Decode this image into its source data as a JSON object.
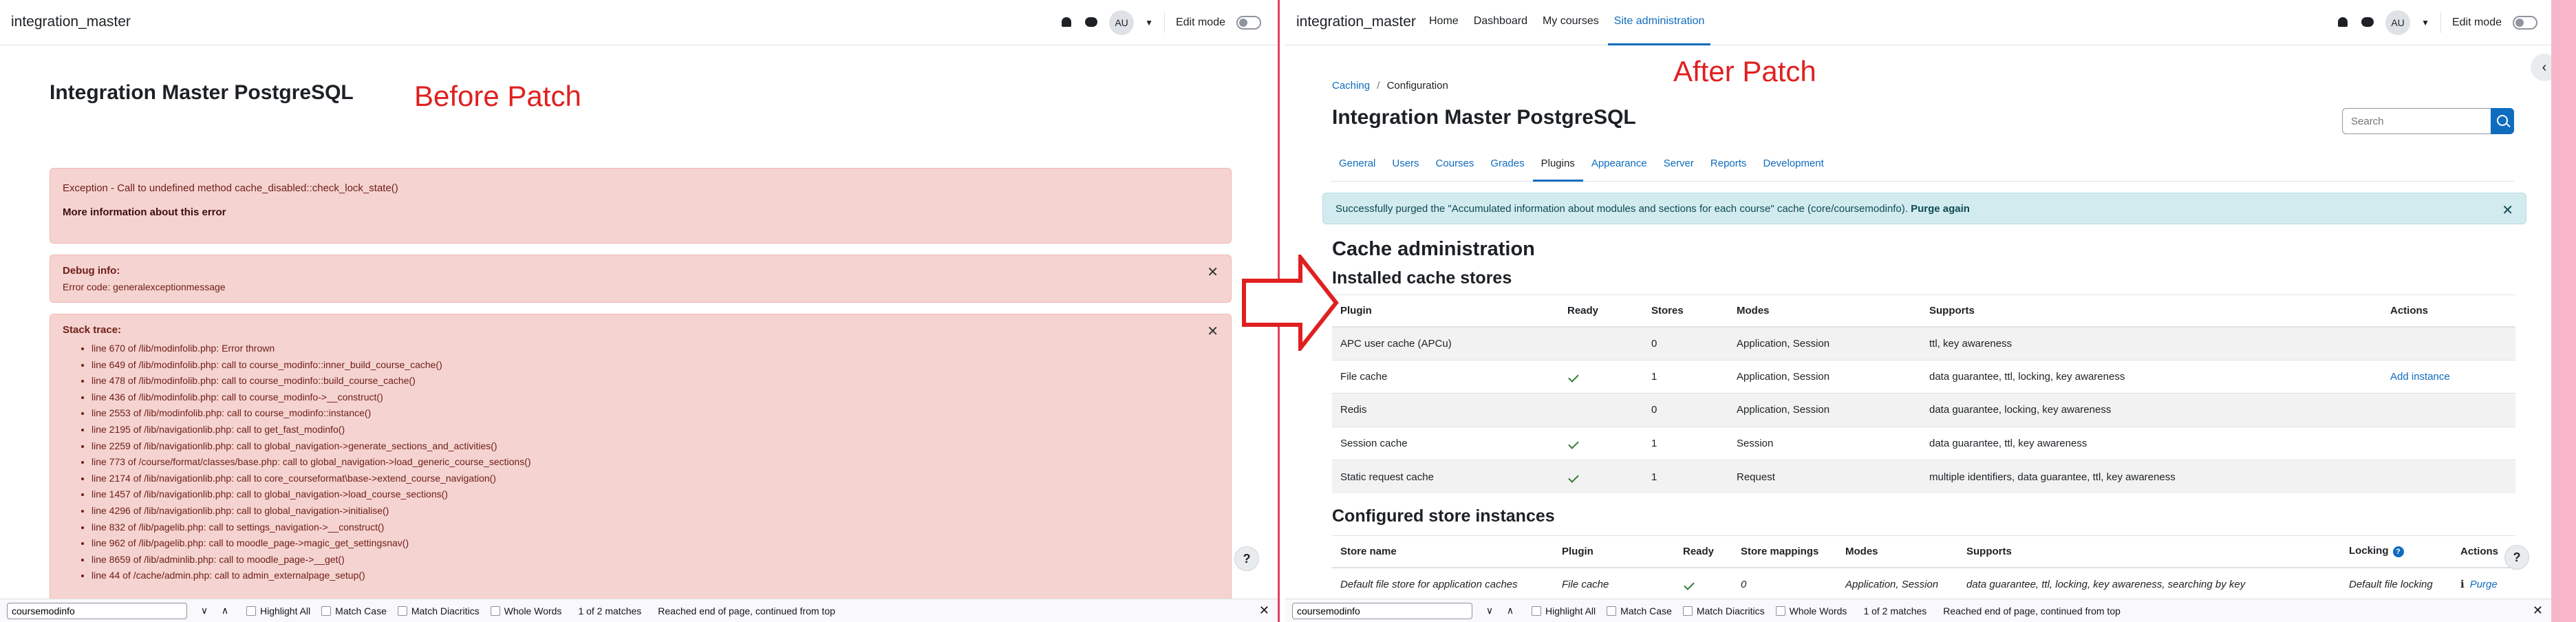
{
  "left": {
    "brand": "integration_master",
    "avatar": "AU",
    "edit_mode": "Edit mode",
    "label": "Before Patch",
    "page_title": "Integration Master PostgreSQL",
    "exception": {
      "message": "Exception - Call to undefined method cache_disabled::check_lock_state()",
      "more_info": "More information about this error"
    },
    "debug": {
      "title": "Debug info:",
      "code": "Error code: generalexceptionmessage"
    },
    "trace": {
      "title": "Stack trace:",
      "lines": [
        "line 670 of /lib/modinfolib.php: Error thrown",
        "line 649 of /lib/modinfolib.php: call to course_modinfo::inner_build_course_cache()",
        "line 478 of /lib/modinfolib.php: call to course_modinfo::build_course_cache()",
        "line 436 of /lib/modinfolib.php: call to course_modinfo->__construct()",
        "line 2553 of /lib/modinfolib.php: call to course_modinfo::instance()",
        "line 2195 of /lib/navigationlib.php: call to get_fast_modinfo()",
        "line 2259 of /lib/navigationlib.php: call to global_navigation->generate_sections_and_activities()",
        "line 773 of /course/format/classes/base.php: call to global_navigation->load_generic_course_sections()",
        "line 2174 of /lib/navigationlib.php: call to core_courseformat\\base->extend_course_navigation()",
        "line 1457 of /lib/navigationlib.php: call to global_navigation->load_course_sections()",
        "line 4296 of /lib/navigationlib.php: call to global_navigation->initialise()",
        "line 832 of /lib/pagelib.php: call to settings_navigation->__construct()",
        "line 962 of /lib/pagelib.php: call to moodle_page->magic_get_settingsnav()",
        "line 8659 of /lib/adminlib.php: call to moodle_page->__get()",
        "line 44 of /cache/admin.php: call to admin_externalpage_setup()"
      ]
    },
    "help": "?",
    "find": {
      "value": "coursemodinfo",
      "highlight": "Highlight All",
      "match_case": "Match Case",
      "diacritics": "Match Diacritics",
      "whole_words": "Whole Words",
      "matches": "1 of 2 matches",
      "status": "Reached end of page, continued from top"
    }
  },
  "right": {
    "brand": "integration_master",
    "nav": [
      "Home",
      "Dashboard",
      "My courses",
      "Site administration"
    ],
    "avatar": "AU",
    "edit_mode": "Edit mode",
    "label": "After Patch",
    "breadcrumb": {
      "link": "Caching",
      "sep": "/",
      "current": "Configuration"
    },
    "page_title": "Integration Master PostgreSQL",
    "search_placeholder": "Search",
    "tabs": [
      "General",
      "Users",
      "Courses",
      "Grades",
      "Plugins",
      "Appearance",
      "Server",
      "Reports",
      "Development"
    ],
    "success": {
      "message": "Successfully purged the \"Accumulated information about modules and sections for each course\" cache (core/coursemodinfo).",
      "action": "Purge again"
    },
    "cache_admin": "Cache administration",
    "installed_title": "Installed cache stores",
    "installed": {
      "headers": [
        "Plugin",
        "Ready",
        "Stores",
        "Modes",
        "Supports",
        "Actions"
      ],
      "rows": [
        {
          "plugin": "APC user cache (APCu)",
          "ready": false,
          "stores": "0",
          "modes": "Application, Session",
          "supports": "ttl, key awareness",
          "action": ""
        },
        {
          "plugin": "File cache",
          "ready": true,
          "stores": "1",
          "modes": "Application, Session",
          "supports": "data guarantee, ttl, locking, key awareness",
          "action": "Add instance"
        },
        {
          "plugin": "Redis",
          "ready": false,
          "stores": "0",
          "modes": "Application, Session",
          "supports": "data guarantee, locking, key awareness",
          "action": ""
        },
        {
          "plugin": "Session cache",
          "ready": true,
          "stores": "1",
          "modes": "Session",
          "supports": "data guarantee, ttl, key awareness",
          "action": ""
        },
        {
          "plugin": "Static request cache",
          "ready": true,
          "stores": "1",
          "modes": "Request",
          "supports": "multiple identifiers, data guarantee, ttl, key awareness",
          "action": ""
        }
      ]
    },
    "configured_title": "Configured store instances",
    "configured": {
      "headers": [
        "Store name",
        "Plugin",
        "Ready",
        "Store mappings",
        "Modes",
        "Supports",
        "Locking",
        "Actions"
      ],
      "rows": [
        {
          "name": "Default file store for application caches",
          "plugin": "File cache",
          "ready": true,
          "mappings": "0",
          "modes": "Application, Session",
          "supports": "data guarantee, ttl, locking, key awareness, searching by key",
          "locking": "Default file locking",
          "action": "Purge"
        }
      ]
    },
    "help": "?",
    "find": {
      "value": "coursemodinfo",
      "highlight": "Highlight All",
      "match_case": "Match Case",
      "diacritics": "Match Diacritics",
      "whole_words": "Whole Words",
      "matches": "1 of 2 matches",
      "status": "Reached end of page, continued from top"
    }
  }
}
